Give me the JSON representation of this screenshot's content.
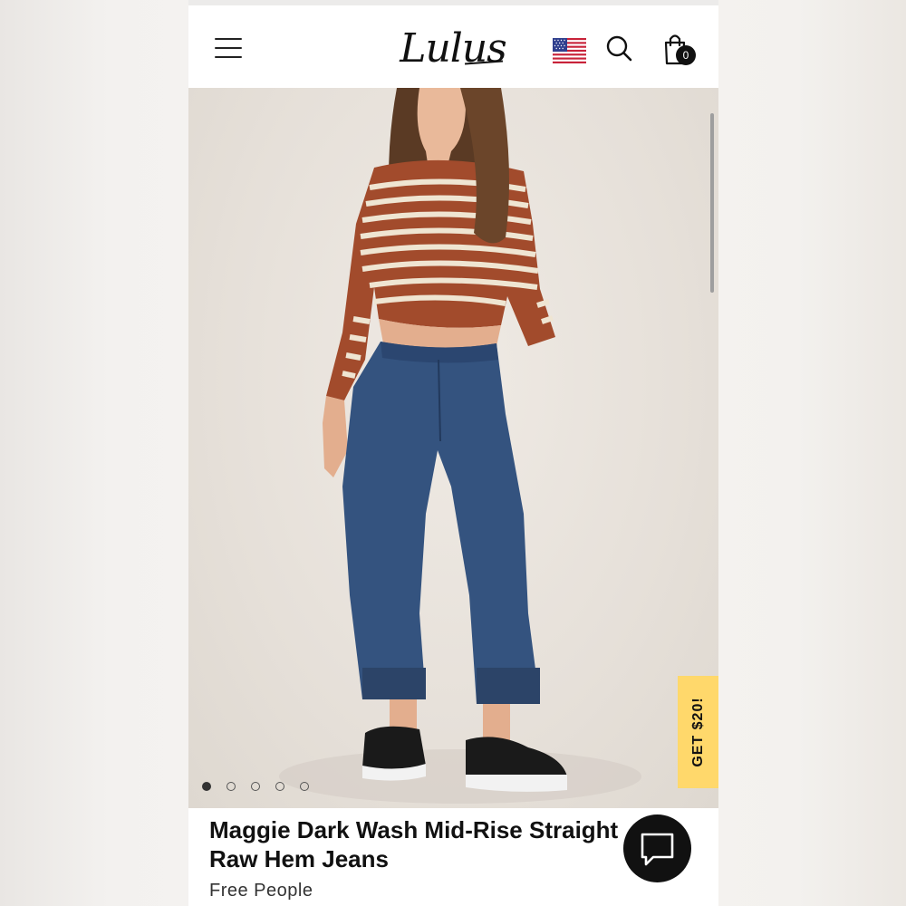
{
  "header": {
    "logo_text": "Lulus",
    "menu_icon": "hamburger-menu-icon",
    "flag_icon": "us-flag-icon",
    "search_icon": "search-icon",
    "cart_icon": "shopping-bag-icon",
    "cart_count": "0"
  },
  "hero": {
    "image": "model-photo",
    "carousel_dots": 5,
    "active_dot": 0,
    "promo_tab": "GET $20!",
    "promo_color": "#ffd86b"
  },
  "product": {
    "title_line1": "Maggie Dark Wash Mid-Rise Straight",
    "title_line2": "Raw Hem Jeans",
    "brand": "Free People"
  },
  "chat": {
    "icon": "chat-bubble-icon"
  }
}
